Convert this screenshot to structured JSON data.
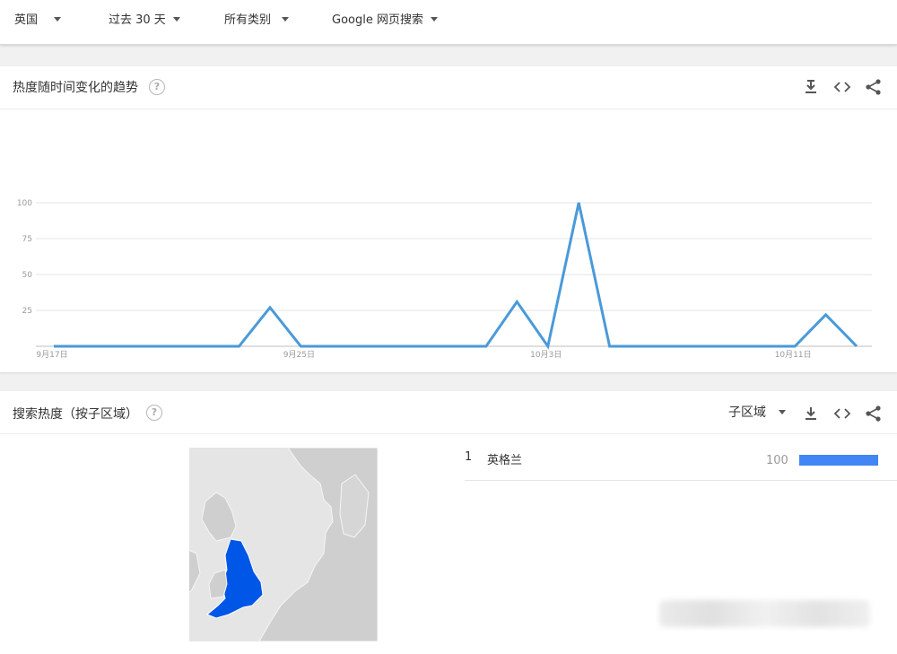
{
  "filters": {
    "region": "英国",
    "time_range": "过去 30 天",
    "category": "所有类别",
    "search_type": "Google 网页搜索"
  },
  "interest_over_time": {
    "title": "热度随时间变化的趋势",
    "help": "?",
    "actions": [
      "download-icon",
      "embed-icon",
      "share-icon"
    ]
  },
  "chart_data": {
    "type": "line",
    "title": "",
    "xlabel": "",
    "ylabel": "",
    "ylim": [
      0,
      100
    ],
    "yticks": [
      25,
      50,
      75,
      100
    ],
    "xtick_labels": [
      "9月17日",
      "9月25日",
      "10月3日",
      "10月11日"
    ],
    "xtick_indices": [
      0,
      8,
      16,
      24
    ],
    "x_count": 27,
    "series": [
      {
        "color": "#4a9ad9",
        "values": [
          0,
          0,
          0,
          0,
          0,
          0,
          0,
          27,
          0,
          0,
          0,
          0,
          0,
          0,
          0,
          31,
          0,
          100,
          0,
          0,
          0,
          0,
          0,
          0,
          0,
          22,
          0
        ]
      }
    ]
  },
  "interest_by_region": {
    "title": "搜索热度（按子区域）",
    "help": "?",
    "resolution": "子区域",
    "actions": [
      "download-icon",
      "embed-icon",
      "share-icon"
    ],
    "rows": [
      {
        "rank": "1",
        "name": "英格兰",
        "value": "100",
        "fill": 1.0
      }
    ],
    "highlight_color": "#0057e7",
    "bar_color": "#4285f4"
  }
}
